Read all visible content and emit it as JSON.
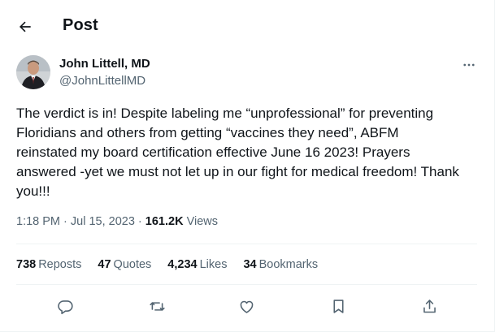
{
  "header": {
    "title": "Post",
    "back_icon": "arrow-left-icon"
  },
  "author": {
    "name": "John Littell, MD",
    "handle": "@JohnLittellMD",
    "more_icon": "ellipsis-icon"
  },
  "post": {
    "text": "The verdict is in! Despite labeling me “unprofessional” for preventing\nFloridians and others from getting “vaccines they need”,  ABFM\nreinstated my board certification effective June 16 2023!  Prayers\nanswered -yet we must not let up in our fight for medical freedom! Thank\nyou!!!",
    "time": "1:18 PM · Jul 15, 2023 · ",
    "views_count": "161.2K",
    "views_label": " Views"
  },
  "stats": {
    "reposts_count": "738",
    "reposts_label": "Reposts",
    "quotes_count": "47",
    "quotes_label": "Quotes",
    "likes_count": "4,234",
    "likes_label": "Likes",
    "bookmarks_count": "34",
    "bookmarks_label": "Bookmarks"
  },
  "actions": [
    "reply-icon",
    "repost-icon",
    "like-icon",
    "bookmark-icon",
    "share-icon"
  ],
  "colors": {
    "text": "#0f1419",
    "secondary": "#536471",
    "divider": "#eff3f4"
  }
}
